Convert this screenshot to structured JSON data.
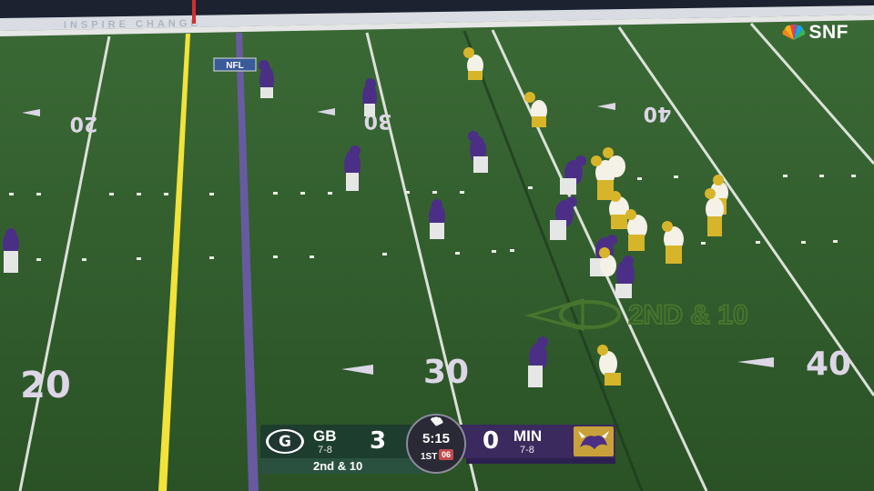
{
  "broadcast": {
    "network": "SNF",
    "stadium_banner": "INSPIRE CHANGE",
    "field_logo": "NFL",
    "down_marker_graphic": "2ND & 10",
    "colors": {
      "turf": "#2f5a2a",
      "first_down_line": "#f2e23a",
      "scrimmage_line": "#6b5aa8"
    }
  },
  "field_numbers": {
    "top": [
      "20",
      "30",
      "40"
    ],
    "bottom": [
      "20",
      "30",
      "40"
    ]
  },
  "scorebug": {
    "home": {
      "abbr": "GB",
      "record": "7-8",
      "score": "3",
      "logo": "G",
      "color": "#1d3d2e"
    },
    "away": {
      "abbr": "MIN",
      "record": "7-8",
      "score": "0",
      "color": "#3a2a5e"
    },
    "clock": "5:15",
    "quarter": "1ST",
    "play_clock": "06",
    "down_distance": "2nd & 10"
  },
  "players": {
    "offense_color": "#f4f1e6",
    "offense_accent": "#d7b52a",
    "defense_color": "#4b2f86"
  }
}
